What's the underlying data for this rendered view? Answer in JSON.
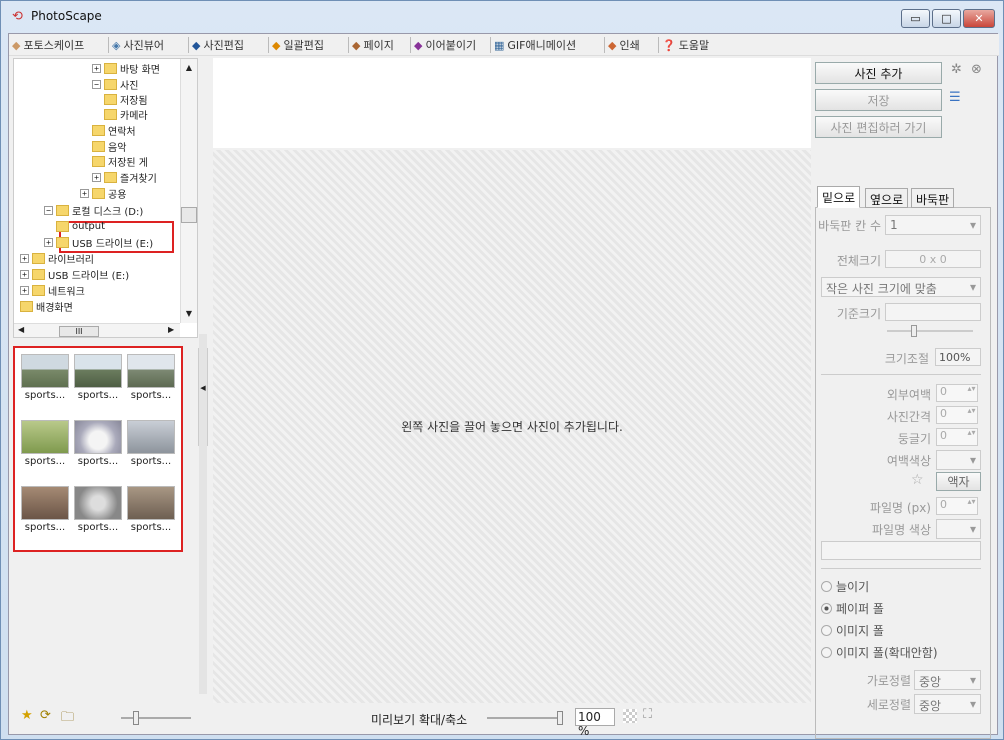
{
  "window": {
    "title": "PhotoScape",
    "controls": {
      "minimize": "▭",
      "maximize": "□",
      "close": "✕"
    }
  },
  "menu": [
    {
      "label": "포토스케이프",
      "icon": "photoscape-icon"
    },
    {
      "label": "사진뷰어",
      "icon": "viewer-icon"
    },
    {
      "label": "사진편집",
      "icon": "editor-icon"
    },
    {
      "label": "일괄편집",
      "icon": "batch-icon"
    },
    {
      "label": "페이지",
      "icon": "page-icon"
    },
    {
      "label": "이어붙이기",
      "icon": "combine-icon"
    },
    {
      "label": "GIF애니메이션",
      "icon": "gif-icon"
    },
    {
      "label": "인쇄",
      "icon": "print-icon"
    },
    {
      "label": "도움말",
      "icon": "help-icon"
    }
  ],
  "tree": [
    {
      "label": "바탕 화면",
      "indent": 6
    },
    {
      "label": "사진",
      "indent": 6
    },
    {
      "label": "저장됨",
      "indent": 7
    },
    {
      "label": "카메라",
      "indent": 7
    },
    {
      "label": "연락처",
      "indent": 6
    },
    {
      "label": "음악",
      "indent": 6
    },
    {
      "label": "저장된 게",
      "indent": 6
    },
    {
      "label": "즐겨찾기",
      "indent": 6
    },
    {
      "label": "공용",
      "indent": 5
    },
    {
      "label": "로컬 디스크 (D:)",
      "indent": 2
    },
    {
      "label": "output",
      "indent": 3
    },
    {
      "label": "USB 드라이브 (E:)",
      "indent": 2
    },
    {
      "label": "라이브러리",
      "indent": 0
    },
    {
      "label": "USB 드라이브 (E:)",
      "indent": 0
    },
    {
      "label": "네트워크",
      "indent": 0
    },
    {
      "label": "배경화면",
      "indent": 0
    }
  ],
  "tree_scroll_label": "III",
  "thumbnails": [
    "sports...",
    "sports...",
    "sports...",
    "sports...",
    "sports...",
    "sports...",
    "sports...",
    "sports...",
    "sports..."
  ],
  "center": {
    "hint": "왼쪽 사진을 끌어 놓으면 사진이 추가됩니다."
  },
  "right": {
    "add_photo": "사진 추가",
    "save": "저장",
    "go_edit": "사진 편집하러 가기",
    "tabs": [
      "밑으로",
      "옆으로",
      "바둑판"
    ],
    "grid_count_label": "바둑판 칸 수",
    "grid_count_value": "1",
    "total_size_label": "전체크기",
    "total_size_value": "0 x 0",
    "fit_option": "작은 사진 크기에 맞춤",
    "base_size_label": "기준크기",
    "size_adjust_label": "크기조절",
    "size_adjust_value": "100%",
    "outer_margin_label": "외부여백",
    "outer_margin_value": "0",
    "photo_gap_label": "사진간격",
    "photo_gap_value": "0",
    "round_label": "둥글기",
    "round_value": "0",
    "margin_color_label": "여백색상",
    "frame_button": "액자",
    "filename_label": "파일명 (px)",
    "filename_value": "0",
    "filename_color_label": "파일명 색상",
    "radios": [
      {
        "label": "늘이기",
        "checked": false
      },
      {
        "label": "페이퍼 폴",
        "checked": true
      },
      {
        "label": "이미지 폴",
        "checked": false
      },
      {
        "label": "이미지 폴(확대안함)",
        "checked": false
      }
    ],
    "h_align_label": "가로정렬",
    "h_align_value": "중앙",
    "v_align_label": "세로정렬",
    "v_align_value": "중앙"
  },
  "status": {
    "zoom_label": "미리보기 확대/축소",
    "zoom_value": "100 %"
  }
}
